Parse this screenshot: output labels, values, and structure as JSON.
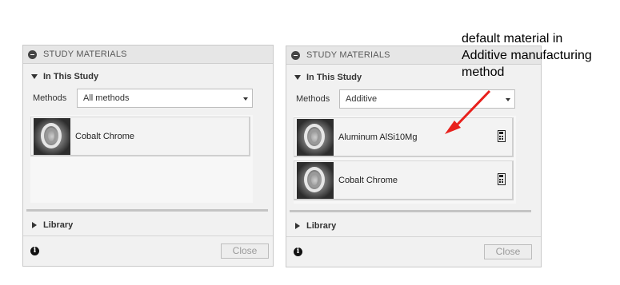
{
  "left_panel": {
    "header": "STUDY MATERIALS",
    "section_title": "In This Study",
    "methods_label": "Methods",
    "methods_value": "All methods",
    "materials": [
      {
        "name": "Cobalt Chrome"
      }
    ],
    "library_label": "Library",
    "info_glyph": "i",
    "close_label": "Close"
  },
  "right_panel": {
    "header": "STUDY MATERIALS",
    "section_title": "In This Study",
    "methods_label": "Methods",
    "methods_value": "Additive",
    "materials": [
      {
        "name": "Aluminum AlSi10Mg"
      },
      {
        "name": "Cobalt Chrome"
      }
    ],
    "library_label": "Library",
    "info_glyph": "i",
    "close_label": "Close"
  },
  "annotation": {
    "lines": [
      "default material in",
      "Additive manufacturing",
      "method"
    ],
    "arrow_color": "#e8201c"
  }
}
